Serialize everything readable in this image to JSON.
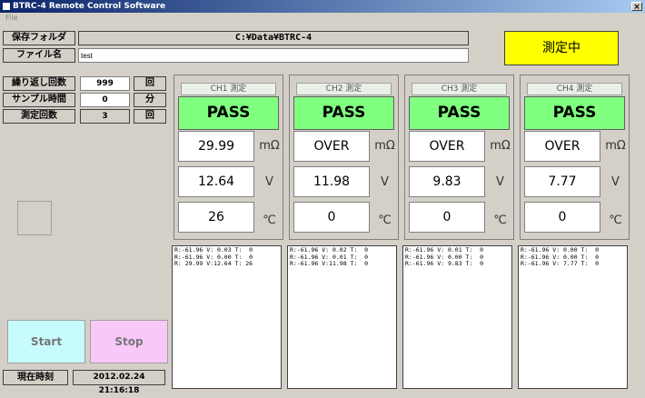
{
  "window": {
    "title": "BTRC-4 Remote Control Software",
    "close": "×"
  },
  "menu": {
    "file": "File"
  },
  "header": {
    "folder_label": "保存フォルダ",
    "folder_value": "C:¥Data¥BTRC-4",
    "filename_label": "ファイル名",
    "filename_value": "test",
    "status": "測定中"
  },
  "settings": {
    "repeat_label": "繰り返し回数",
    "repeat_value": "999",
    "repeat_unit": "回",
    "sample_label": "サンプル時間",
    "sample_value": "0",
    "sample_unit": "分",
    "count_label": "測定回数",
    "count_value": "3",
    "count_unit": "回"
  },
  "channels": [
    {
      "title": "CH1 測定",
      "status": "PASS",
      "resistance": "29.99",
      "voltage": "12.64",
      "temperature": "26",
      "log": "R:-61.96 V: 0.03 T:  0\nR:-61.96 V: 0.00 T:  0\nR: 29.99 V:12.64 T: 26"
    },
    {
      "title": "CH2 測定",
      "status": "PASS",
      "resistance": "OVER",
      "voltage": "11.98",
      "temperature": "0",
      "log": "R:-61.96 V: 0.02 T:  0\nR:-61.96 V: 0.01 T:  0\nR:-61.96 V:11.98 T:  0"
    },
    {
      "title": "CH3 測定",
      "status": "PASS",
      "resistance": "OVER",
      "voltage": "9.83",
      "temperature": "0",
      "log": "R:-61.96 V: 0.01 T:  0\nR:-61.96 V: 0.00 T:  0\nR:-61.96 V: 9.83 T:  0"
    },
    {
      "title": "CH4 測定",
      "status": "PASS",
      "resistance": "OVER",
      "voltage": "7.77",
      "temperature": "0",
      "log": "R:-61.96 V: 0.00 T:  0\nR:-61.96 V: 0.00 T:  0\nR:-61.96 V: 7.77 T:  0"
    }
  ],
  "units": {
    "resistance": "mΩ",
    "voltage": "V",
    "temperature": "℃"
  },
  "buttons": {
    "start": "Start",
    "stop": "Stop"
  },
  "clock": {
    "label": "現在時刻",
    "value": "2012.02.24 21:16:18"
  },
  "colors": {
    "pass": "#80ff80",
    "status_bg": "#ffff00",
    "start_bg": "#c8fcfc",
    "stop_bg": "#f8c8f8"
  }
}
